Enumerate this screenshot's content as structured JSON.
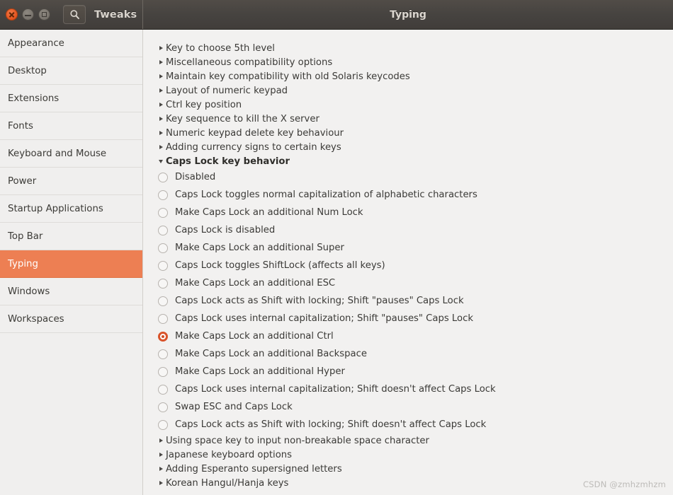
{
  "titlebar": {
    "app_name": "Tweaks",
    "window_title": "Typing",
    "search_icon": "search-icon",
    "close_icon": "close-icon",
    "minimize_icon": "minimize-icon",
    "maximize_icon": "maximize-icon",
    "accent_color": "#ed7f53",
    "bar_color": "#464340"
  },
  "sidebar": {
    "items": [
      {
        "label": "Appearance",
        "selected": false
      },
      {
        "label": "Desktop",
        "selected": false
      },
      {
        "label": "Extensions",
        "selected": false
      },
      {
        "label": "Fonts",
        "selected": false
      },
      {
        "label": "Keyboard and Mouse",
        "selected": false
      },
      {
        "label": "Power",
        "selected": false
      },
      {
        "label": "Startup Applications",
        "selected": false
      },
      {
        "label": "Top Bar",
        "selected": false
      },
      {
        "label": "Typing",
        "selected": true
      },
      {
        "label": "Windows",
        "selected": false
      },
      {
        "label": "Workspaces",
        "selected": false
      }
    ]
  },
  "content": {
    "tree_top": [
      {
        "label": "Key to choose 5th level",
        "expanded": false
      },
      {
        "label": "Miscellaneous compatibility options",
        "expanded": false
      },
      {
        "label": "Maintain key compatibility with old Solaris keycodes",
        "expanded": false
      },
      {
        "label": "Layout of numeric keypad",
        "expanded": false
      },
      {
        "label": "Ctrl key position",
        "expanded": false
      },
      {
        "label": "Key sequence to kill the X server",
        "expanded": false
      },
      {
        "label": "Numeric keypad delete key behaviour",
        "expanded": false
      },
      {
        "label": "Adding currency signs to certain keys",
        "expanded": false
      },
      {
        "label": "Caps Lock key behavior",
        "expanded": true
      }
    ],
    "caps_lock_options": [
      {
        "label": "Disabled",
        "checked": false
      },
      {
        "label": "Caps Lock toggles normal capitalization of alphabetic characters",
        "checked": false
      },
      {
        "label": "Make Caps Lock an additional Num Lock",
        "checked": false
      },
      {
        "label": "Caps Lock is disabled",
        "checked": false
      },
      {
        "label": "Make Caps Lock an additional Super",
        "checked": false
      },
      {
        "label": "Caps Lock toggles ShiftLock (affects all keys)",
        "checked": false
      },
      {
        "label": "Make Caps Lock an additional ESC",
        "checked": false
      },
      {
        "label": "Caps Lock acts as Shift with locking; Shift \"pauses\" Caps Lock",
        "checked": false
      },
      {
        "label": "Caps Lock uses internal capitalization; Shift \"pauses\" Caps Lock",
        "checked": false
      },
      {
        "label": "Make Caps Lock an additional Ctrl",
        "checked": true
      },
      {
        "label": "Make Caps Lock an additional Backspace",
        "checked": false
      },
      {
        "label": "Make Caps Lock an additional Hyper",
        "checked": false
      },
      {
        "label": "Caps Lock uses internal capitalization; Shift doesn't affect Caps Lock",
        "checked": false
      },
      {
        "label": "Swap ESC and Caps Lock",
        "checked": false
      },
      {
        "label": "Caps Lock acts as Shift with locking; Shift doesn't affect Caps Lock",
        "checked": false
      }
    ],
    "tree_bottom": [
      {
        "label": "Using space key to input non-breakable space character",
        "expanded": false
      },
      {
        "label": "Japanese keyboard options",
        "expanded": false
      },
      {
        "label": "Adding Esperanto supersigned letters",
        "expanded": false
      },
      {
        "label": "Korean Hangul/Hanja keys",
        "expanded": false
      }
    ]
  },
  "watermark": "CSDN @zmhzmhzm"
}
